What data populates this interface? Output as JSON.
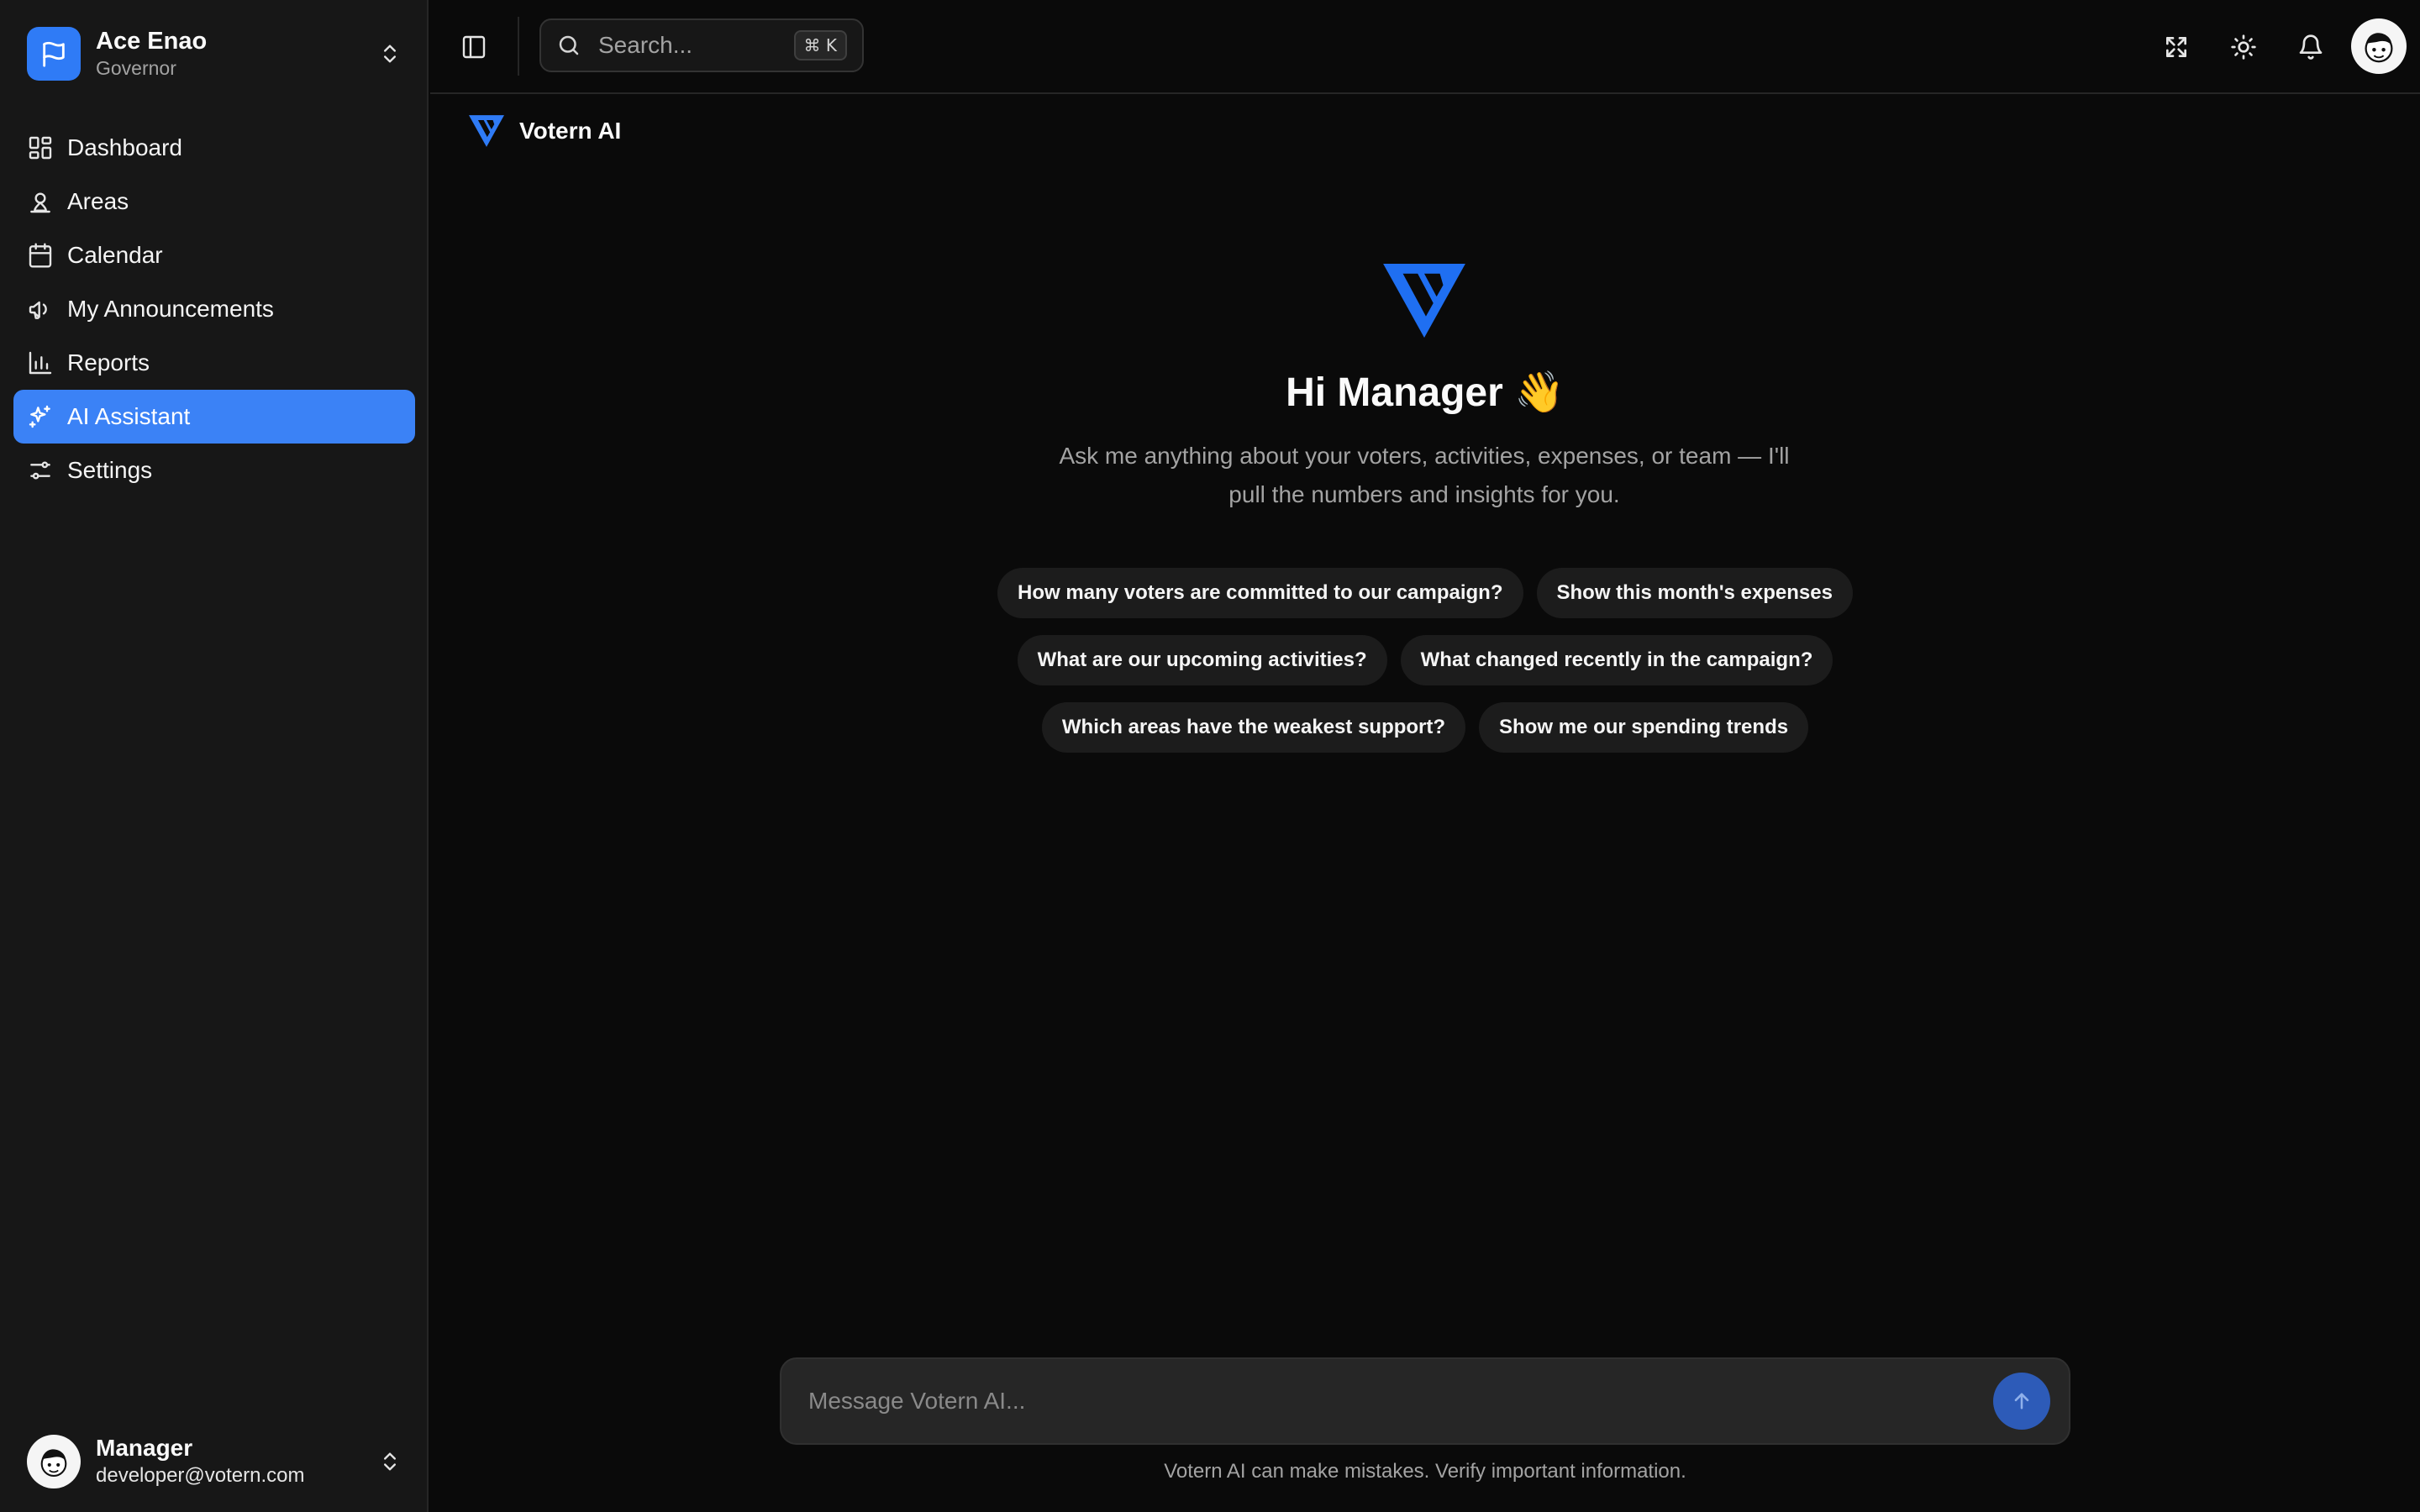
{
  "org": {
    "name": "Ace Enao",
    "role": "Governor"
  },
  "nav": [
    {
      "label": "Dashboard",
      "icon": "dashboard-icon"
    },
    {
      "label": "Areas",
      "icon": "map-pin-icon"
    },
    {
      "label": "Calendar",
      "icon": "calendar-icon"
    },
    {
      "label": "My Announcements",
      "icon": "megaphone-icon"
    },
    {
      "label": "Reports",
      "icon": "bar-chart-icon"
    },
    {
      "label": "AI Assistant",
      "icon": "sparkles-icon",
      "active": true
    },
    {
      "label": "Settings",
      "icon": "sliders-icon"
    }
  ],
  "user": {
    "name": "Manager",
    "email": "developer@votern.com"
  },
  "topbar": {
    "search_placeholder": "Search...",
    "shortcut": "⌘ K"
  },
  "header": {
    "brand": "Votern AI"
  },
  "hero": {
    "title": "Hi Manager 👋",
    "subtitle_line1": "Ask me anything about your voters, activities, expenses, or team — I'll",
    "subtitle_line2": "pull the numbers and insights for you."
  },
  "suggestions": [
    [
      "How many voters are committed to our campaign?",
      "Show this month's expenses"
    ],
    [
      "What are our upcoming activities?",
      "What changed recently in the campaign?"
    ],
    [
      "Which areas have the weakest support?",
      "Show me our spending trends"
    ]
  ],
  "composer": {
    "placeholder": "Message Votern AI..."
  },
  "disclaimer": "Votern AI can make mistakes. Verify important information.",
  "colors": {
    "accent": "#3b82f6",
    "background": "#0a0a0a",
    "sidebar": "#171717"
  }
}
